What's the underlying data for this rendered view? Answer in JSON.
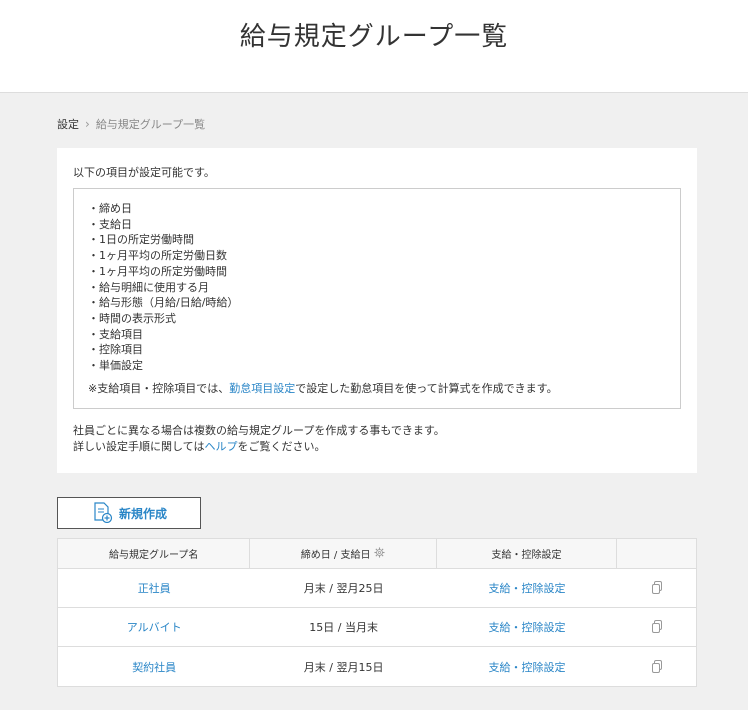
{
  "page": {
    "title": "給与規定グループ一覧"
  },
  "breadcrumb": {
    "root": "設定",
    "current": "給与規定グループ一覧"
  },
  "info": {
    "intro": "以下の項目が設定可能です。",
    "items": [
      "・締め日",
      "・支給日",
      "・1日の所定労働時間",
      "・1ヶ月平均の所定労働日数",
      "・1ヶ月平均の所定労働時間",
      "・給与明細に使用する月",
      "・給与形態（月給/日給/時給）",
      "・時間の表示形式",
      "・支給項目",
      "・控除項目",
      "・単価設定"
    ],
    "note_prefix": "※支給項目・控除項目では、",
    "note_link": "勤怠項目設定",
    "note_suffix": "で設定した勤怠項目を使って計算式を作成できます。",
    "footer1": "社員ごとに異なる場合は複数の給与規定グループを作成する事もできます。",
    "footer2_prefix": "詳しい設定手順に関しては",
    "footer2_link": "ヘルプ",
    "footer2_suffix": "をご覧ください。"
  },
  "new_button": {
    "label": "新規作成",
    "icon": "document-add-icon"
  },
  "table": {
    "headers": [
      "給与規定グループ名",
      "締め日 / 支給日",
      "支給・控除設定",
      ""
    ],
    "rows": [
      {
        "name": "正社員",
        "dates": "月末 / 翌月25日",
        "setting": "支給・控除設定"
      },
      {
        "name": "アルバイト",
        "dates": "15日 / 当月末",
        "setting": "支給・控除設定"
      },
      {
        "name": "契約社員",
        "dates": "月末 / 翌月15日",
        "setting": "支給・控除設定"
      }
    ]
  }
}
